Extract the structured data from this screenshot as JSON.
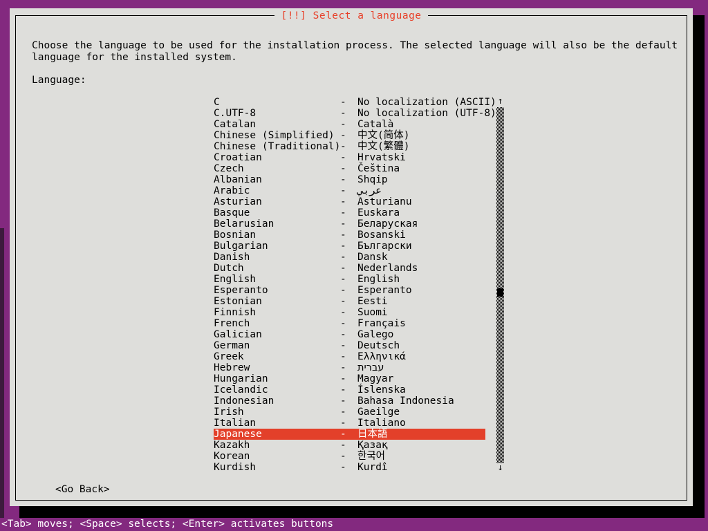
{
  "window": {
    "title": "[!!] Select a language",
    "accent_red": "#e8412a",
    "highlight_bg": "#e3402a",
    "dialog_bg": "#dededb",
    "desktop_bg": "#83297f"
  },
  "content": {
    "description": "Choose the language to be used for the installation process. The selected language will also be the default language for the installed system.",
    "language_label": "Language:"
  },
  "scrollbar": {
    "up_arrow": "↑",
    "down_arrow": "↓"
  },
  "buttons": {
    "go_back": "<Go Back>"
  },
  "status": {
    "help_text": "<Tab> moves; <Space> selects; <Enter> activates buttons"
  },
  "languages": [
    {
      "name": "C",
      "dash": "-",
      "native": "No localization (ASCII)",
      "selected": false
    },
    {
      "name": "C.UTF-8",
      "dash": "-",
      "native": "No localization (UTF-8)",
      "selected": false
    },
    {
      "name": "Catalan",
      "dash": "-",
      "native": "Català",
      "selected": false
    },
    {
      "name": "Chinese (Simplified)",
      "dash": "-",
      "native": "中文(简体)",
      "selected": false
    },
    {
      "name": "Chinese (Traditional)",
      "dash": "-",
      "native": "中文(繁體)",
      "selected": false
    },
    {
      "name": "Croatian",
      "dash": "-",
      "native": "Hrvatski",
      "selected": false
    },
    {
      "name": "Czech",
      "dash": "-",
      "native": "Čeština",
      "selected": false
    },
    {
      "name": "Albanian",
      "dash": "-",
      "native": "Shqip",
      "selected": false
    },
    {
      "name": "Arabic",
      "dash": "-",
      "native": "عربي",
      "selected": false
    },
    {
      "name": "Asturian",
      "dash": "-",
      "native": "Asturianu",
      "selected": false
    },
    {
      "name": "Basque",
      "dash": "-",
      "native": "Euskara",
      "selected": false
    },
    {
      "name": "Belarusian",
      "dash": "-",
      "native": "Беларуская",
      "selected": false
    },
    {
      "name": "Bosnian",
      "dash": "-",
      "native": "Bosanski",
      "selected": false
    },
    {
      "name": "Bulgarian",
      "dash": "-",
      "native": "Български",
      "selected": false
    },
    {
      "name": "Danish",
      "dash": "-",
      "native": "Dansk",
      "selected": false
    },
    {
      "name": "Dutch",
      "dash": "-",
      "native": "Nederlands",
      "selected": false
    },
    {
      "name": "English",
      "dash": "-",
      "native": "English",
      "selected": false
    },
    {
      "name": "Esperanto",
      "dash": "-",
      "native": "Esperanto",
      "selected": false
    },
    {
      "name": "Estonian",
      "dash": "-",
      "native": "Eesti",
      "selected": false
    },
    {
      "name": "Finnish",
      "dash": "-",
      "native": "Suomi",
      "selected": false
    },
    {
      "name": "French",
      "dash": "-",
      "native": "Français",
      "selected": false
    },
    {
      "name": "Galician",
      "dash": "-",
      "native": "Galego",
      "selected": false
    },
    {
      "name": "German",
      "dash": "-",
      "native": "Deutsch",
      "selected": false
    },
    {
      "name": "Greek",
      "dash": "-",
      "native": "Ελληνικά",
      "selected": false
    },
    {
      "name": "Hebrew",
      "dash": "-",
      "native": "עברית",
      "selected": false
    },
    {
      "name": "Hungarian",
      "dash": "-",
      "native": "Magyar",
      "selected": false
    },
    {
      "name": "Icelandic",
      "dash": "-",
      "native": "Íslenska",
      "selected": false
    },
    {
      "name": "Indonesian",
      "dash": "-",
      "native": "Bahasa Indonesia",
      "selected": false
    },
    {
      "name": "Irish",
      "dash": "-",
      "native": "Gaeilge",
      "selected": false
    },
    {
      "name": "Italian",
      "dash": "-",
      "native": "Italiano",
      "selected": false
    },
    {
      "name": "Japanese",
      "dash": "-",
      "native": "日本語",
      "selected": true
    },
    {
      "name": "Kazakh",
      "dash": "-",
      "native": "Қазақ",
      "selected": false
    },
    {
      "name": "Korean",
      "dash": "-",
      "native": "한국어",
      "selected": false
    },
    {
      "name": "Kurdish",
      "dash": "-",
      "native": "Kurdî",
      "selected": false
    }
  ]
}
